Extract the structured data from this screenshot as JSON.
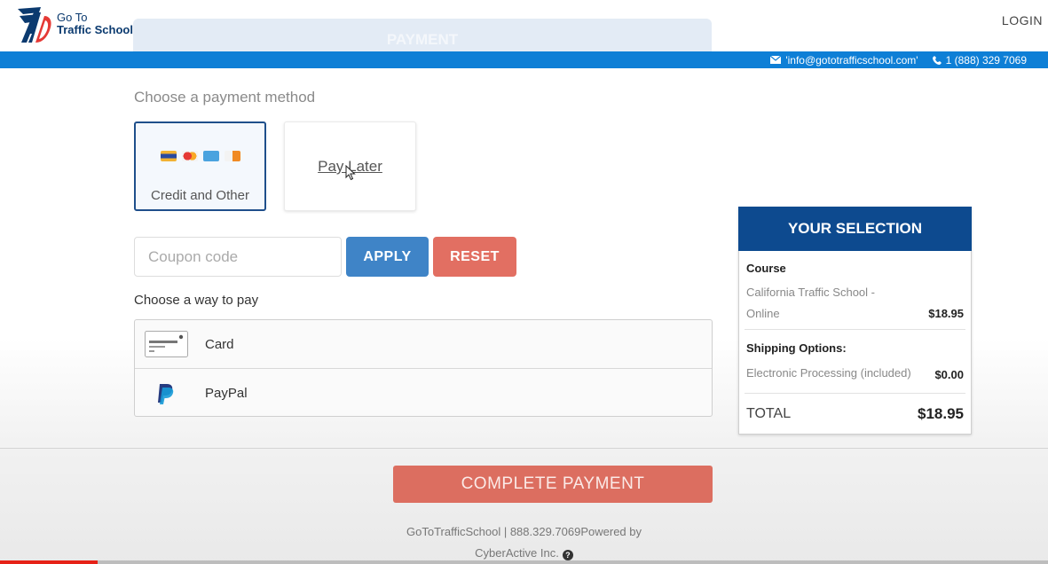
{
  "header": {
    "logo_line1": "Go To",
    "logo_line2": "Traffic School",
    "tab_title": "PAYMENT",
    "login_label": "LOGIN",
    "email": "'info@gototrafficschool.com'",
    "phone": "1 (888) 329 7069",
    "bar_color": "#0e7fd6"
  },
  "payment_method": {
    "title": "Choose a payment method",
    "options": [
      {
        "label": "Credit and Other",
        "selected": true
      },
      {
        "label": "Pay Later",
        "selected": false
      }
    ],
    "card_icons": [
      "visa-card-icon",
      "mastercard-icon",
      "amex-card-icon",
      "discover-card-icon"
    ]
  },
  "coupon": {
    "placeholder": "Coupon code",
    "value": "",
    "apply_label": "APPLY",
    "reset_label": "RESET"
  },
  "way_to_pay": {
    "title": "Choose a way to pay",
    "options": [
      {
        "label": "Card",
        "icon": "credit-card-icon"
      },
      {
        "label": "PayPal",
        "icon": "paypal-icon"
      }
    ]
  },
  "selection": {
    "title": "YOUR SELECTION",
    "course_title": "Course",
    "course_name": "California Traffic School - Online",
    "course_price": "$18.95",
    "shipping_title": "Shipping Options:",
    "shipping_name": "Electronic Processing (included)",
    "shipping_price": "$0.00",
    "total_label": "TOTAL",
    "total_value": "$18.95",
    "header_color": "#0d4a8f"
  },
  "footer": {
    "complete_label": "COMPLETE PAYMENT",
    "line1": "GoToTrafficSchool | 888.329.7069Powered by",
    "line2": "CyberActive Inc."
  },
  "video_progress": 0.093
}
